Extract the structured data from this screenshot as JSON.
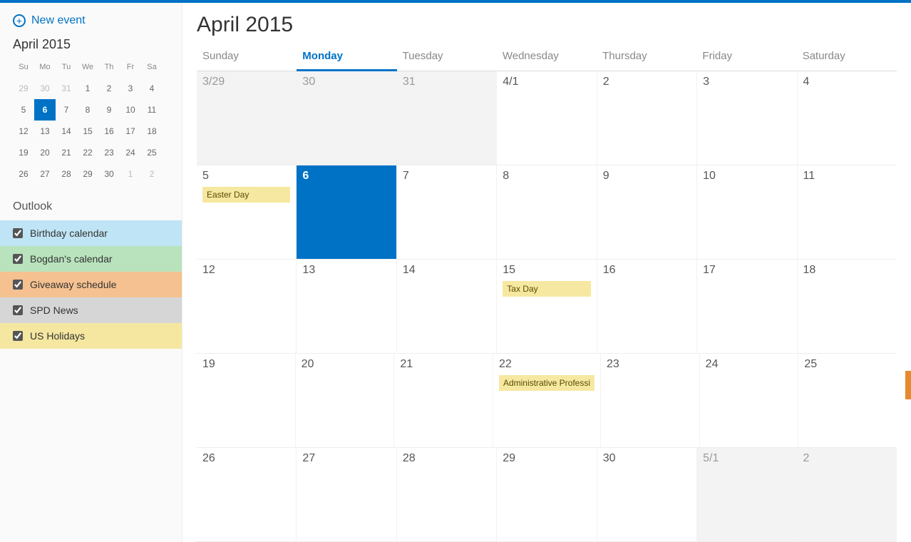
{
  "colors": {
    "accent": "#0072c6",
    "event_yellow": "#f6e8a0",
    "cal_birthday": "#bfe4f5",
    "cal_bogdan": "#b9e3bd",
    "cal_giveaway": "#f5c190",
    "cal_spd": "#d6d6d6",
    "cal_holidays": "#f5e7a0"
  },
  "sidebar": {
    "new_event_label": "New event",
    "mini_title": "April 2015",
    "mini_dow": [
      "Su",
      "Mo",
      "Tu",
      "We",
      "Th",
      "Fr",
      "Sa"
    ],
    "mini_weeks": [
      [
        {
          "n": "29",
          "o": true
        },
        {
          "n": "30",
          "o": true
        },
        {
          "n": "31",
          "o": true
        },
        {
          "n": "1"
        },
        {
          "n": "2"
        },
        {
          "n": "3"
        },
        {
          "n": "4"
        }
      ],
      [
        {
          "n": "5"
        },
        {
          "n": "6",
          "sel": true
        },
        {
          "n": "7"
        },
        {
          "n": "8"
        },
        {
          "n": "9"
        },
        {
          "n": "10"
        },
        {
          "n": "11"
        }
      ],
      [
        {
          "n": "12"
        },
        {
          "n": "13"
        },
        {
          "n": "14"
        },
        {
          "n": "15"
        },
        {
          "n": "16"
        },
        {
          "n": "17"
        },
        {
          "n": "18"
        }
      ],
      [
        {
          "n": "19"
        },
        {
          "n": "20"
        },
        {
          "n": "21"
        },
        {
          "n": "22"
        },
        {
          "n": "23"
        },
        {
          "n": "24"
        },
        {
          "n": "25"
        }
      ],
      [
        {
          "n": "26"
        },
        {
          "n": "27"
        },
        {
          "n": "28"
        },
        {
          "n": "29"
        },
        {
          "n": "30"
        },
        {
          "n": "1",
          "o": true
        },
        {
          "n": "2",
          "o": true
        }
      ]
    ],
    "section_label": "Outlook",
    "calendars": [
      {
        "label": "Birthday calendar",
        "checked": true,
        "color": "cal_birthday"
      },
      {
        "label": "Bogdan's calendar",
        "checked": true,
        "color": "cal_bogdan"
      },
      {
        "label": "Giveaway schedule",
        "checked": true,
        "color": "cal_giveaway"
      },
      {
        "label": "SPD News",
        "checked": true,
        "color": "cal_spd"
      },
      {
        "label": "US Holidays",
        "checked": true,
        "color": "cal_holidays"
      }
    ]
  },
  "main": {
    "title": "April 2015",
    "dow": [
      "Sunday",
      "Monday",
      "Tuesday",
      "Wednesday",
      "Thursday",
      "Friday",
      "Saturday"
    ],
    "active_dow_index": 1,
    "weeks": [
      [
        {
          "label": "3/29",
          "other": true
        },
        {
          "label": "30",
          "other": true
        },
        {
          "label": "31",
          "other": true
        },
        {
          "label": "4/1"
        },
        {
          "label": "2"
        },
        {
          "label": "3"
        },
        {
          "label": "4"
        }
      ],
      [
        {
          "label": "5",
          "events": [
            {
              "text": "Easter Day",
              "style": "yellow"
            }
          ]
        },
        {
          "label": "6",
          "today": true
        },
        {
          "label": "7"
        },
        {
          "label": "8"
        },
        {
          "label": "9"
        },
        {
          "label": "10"
        },
        {
          "label": "11"
        }
      ],
      [
        {
          "label": "12"
        },
        {
          "label": "13"
        },
        {
          "label": "14"
        },
        {
          "label": "15",
          "events": [
            {
              "text": "Tax Day",
              "style": "yellow"
            }
          ]
        },
        {
          "label": "16"
        },
        {
          "label": "17"
        },
        {
          "label": "18"
        }
      ],
      [
        {
          "label": "19"
        },
        {
          "label": "20"
        },
        {
          "label": "21"
        },
        {
          "label": "22",
          "events": [
            {
              "text": "Administrative Professi",
              "style": "yellow"
            }
          ]
        },
        {
          "label": "23"
        },
        {
          "label": "24"
        },
        {
          "label": "25"
        }
      ],
      [
        {
          "label": "26"
        },
        {
          "label": "27"
        },
        {
          "label": "28"
        },
        {
          "label": "29"
        },
        {
          "label": "30"
        },
        {
          "label": "5/1",
          "other": true
        },
        {
          "label": "2",
          "other": true
        }
      ]
    ]
  }
}
